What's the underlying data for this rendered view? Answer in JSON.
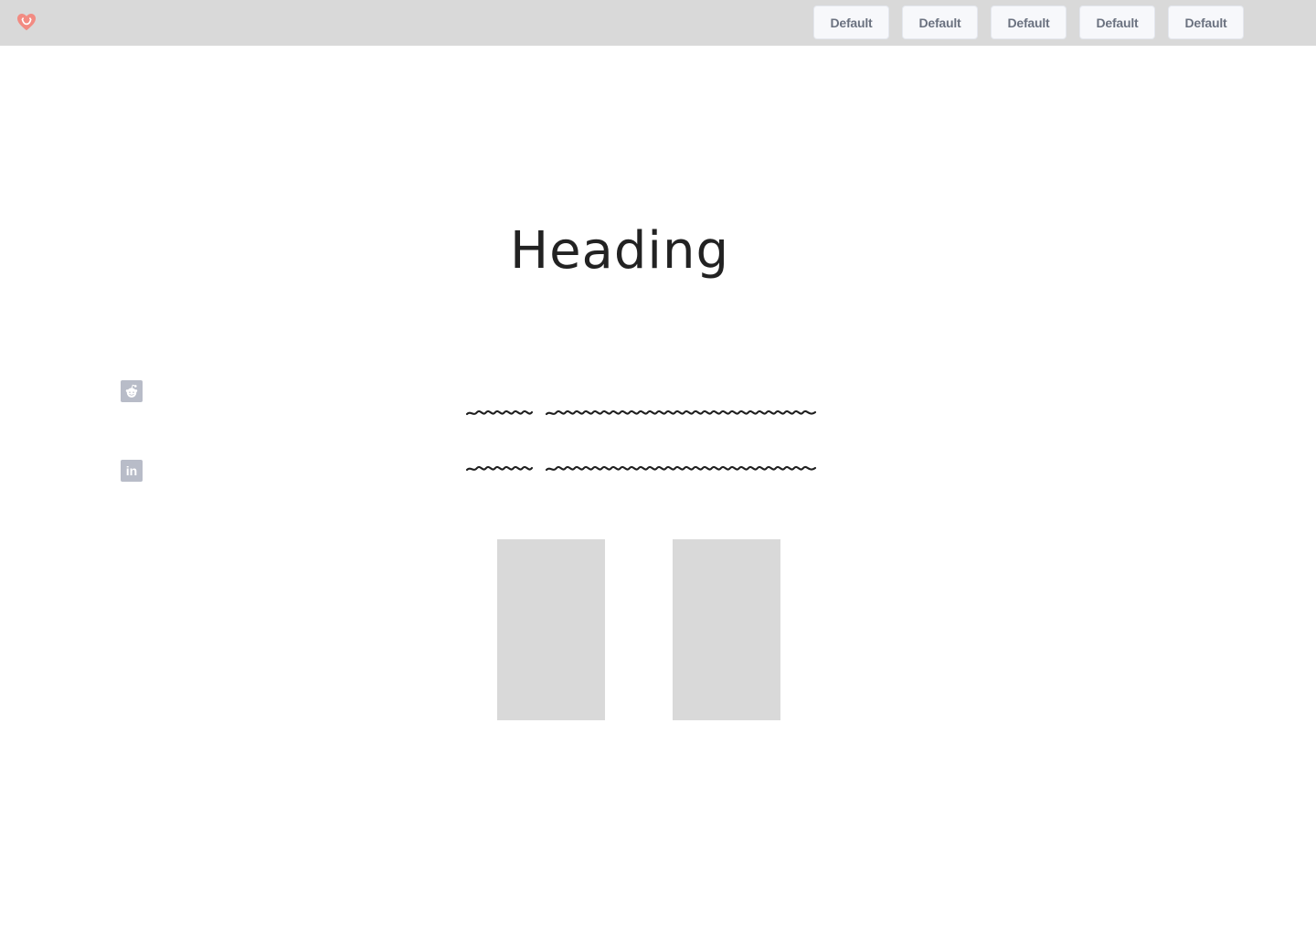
{
  "header": {
    "logo_icon": "heart-logo-icon",
    "nav_buttons": [
      "Default",
      "Default",
      "Default",
      "Default",
      "Default"
    ]
  },
  "main": {
    "heading": "Heading",
    "social_icons": [
      "reddit-icon",
      "linkedin-icon"
    ],
    "social_labels": {
      "linkedin": "in"
    },
    "text_lines": [
      "",
      ""
    ],
    "image_placeholders": 2
  },
  "colors": {
    "top_bar": "#d9d9d9",
    "logo": "#f28b82",
    "button_text": "#6b7280",
    "button_background": "#f7f8fb",
    "social_icon": "#b8bcc8",
    "placeholder": "#d9d9d9",
    "heading": "#222222"
  }
}
